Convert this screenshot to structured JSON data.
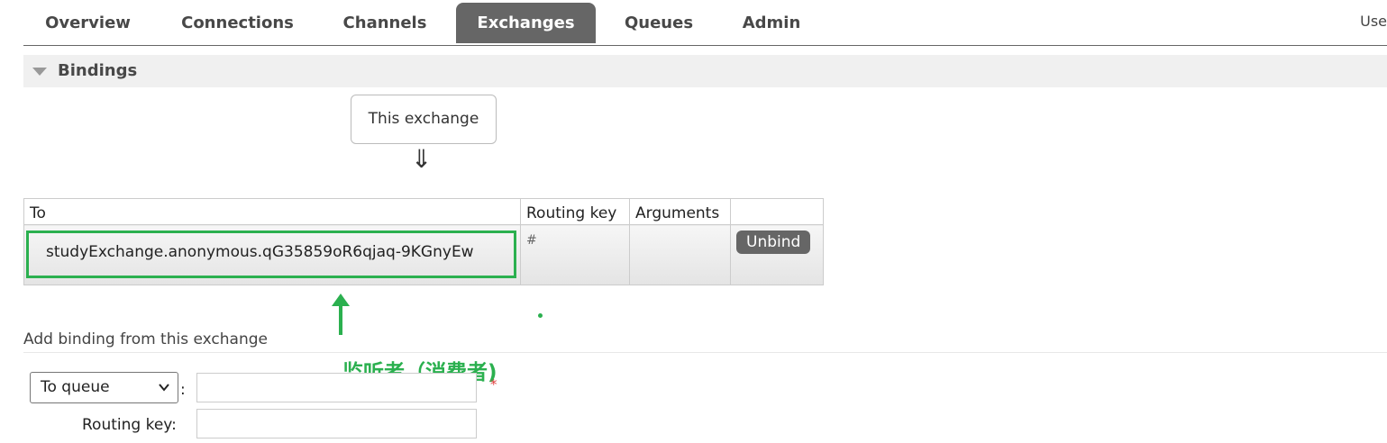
{
  "nav": {
    "tabs": [
      {
        "label": "Overview"
      },
      {
        "label": "Connections"
      },
      {
        "label": "Channels"
      },
      {
        "label": "Exchanges"
      },
      {
        "label": "Queues"
      },
      {
        "label": "Admin"
      }
    ],
    "active_tab": "Exchanges",
    "user_text": "Use"
  },
  "bindings": {
    "title": "Bindings",
    "this_exchange": "This exchange",
    "arrow": "⇓",
    "columns": [
      "To",
      "Routing key",
      "Arguments",
      ""
    ],
    "rows": [
      {
        "to": "studyExchange.anonymous.qG35859oR6qjaq-9KGnyEw",
        "routing_key": "#",
        "arguments": "",
        "action": "Unbind"
      }
    ]
  },
  "annotation": {
    "label": "监听者（消费者)",
    "color": "#2bb04f"
  },
  "add_binding": {
    "title": "Add binding from this exchange",
    "destination_type": "To queue",
    "colon": ":",
    "destination_value": "",
    "required_mark": "*",
    "routing_key_label": "Routing key:",
    "routing_key_value": ""
  }
}
